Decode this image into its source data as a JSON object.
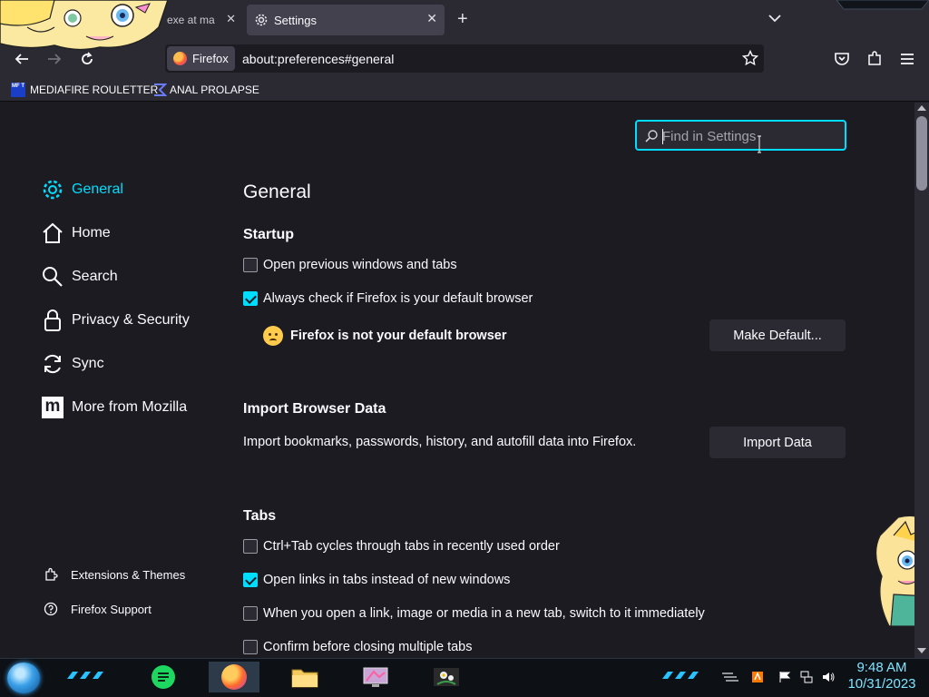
{
  "browser": {
    "tabs": [
      {
        "label": "exe at ma",
        "active": false
      },
      {
        "label": "Settings",
        "active": true
      }
    ],
    "identity_label": "Firefox",
    "url": "about:preferences#general",
    "bookmarks": [
      {
        "label": "MEDIAFIRE ROULETTER",
        "icon": "mediafire-icon",
        "icon_text": "MF T"
      },
      {
        "label": "ANAL PROLAPSE",
        "icon": "sigma-icon"
      }
    ]
  },
  "search": {
    "placeholder": "Find in Settings",
    "value": ""
  },
  "sidebar": {
    "items": [
      {
        "label": "General",
        "icon": "gear-icon",
        "active": true
      },
      {
        "label": "Home",
        "icon": "home-icon"
      },
      {
        "label": "Search",
        "icon": "search-icon"
      },
      {
        "label": "Privacy & Security",
        "icon": "lock-icon"
      },
      {
        "label": "Sync",
        "icon": "sync-icon"
      },
      {
        "label": "More from Mozilla",
        "icon": "mozilla-icon",
        "icon_text": "m"
      }
    ],
    "footer": [
      {
        "label": "Extensions & Themes",
        "icon": "puzzle-icon"
      },
      {
        "label": "Firefox Support",
        "icon": "help-icon"
      }
    ]
  },
  "main": {
    "title": "General",
    "startup": {
      "heading": "Startup",
      "options": [
        {
          "label": "Open previous windows and tabs",
          "checked": false
        },
        {
          "label": "Always check if Firefox is your default browser",
          "checked": true
        }
      ],
      "default_status": "Firefox is not your default browser",
      "default_button": "Make Default..."
    },
    "import": {
      "heading": "Import Browser Data",
      "description": "Import bookmarks, passwords, history, and autofill data into Firefox.",
      "button": "Import Data"
    },
    "tabs": {
      "heading": "Tabs",
      "options": [
        {
          "label": "Ctrl+Tab cycles through tabs in recently used order",
          "checked": false
        },
        {
          "label": "Open links in tabs instead of new windows",
          "checked": true
        },
        {
          "label": "When you open a link, image or media in a new tab, switch to it immediately",
          "checked": false
        },
        {
          "label": "Confirm before closing multiple tabs",
          "checked": false
        }
      ]
    }
  },
  "taskbar": {
    "time": "9:48 AM",
    "date": "10/31/2023"
  },
  "colors": {
    "accent": "#00ddff",
    "background": "#1c1b22",
    "chrome": "#2b2a33"
  }
}
